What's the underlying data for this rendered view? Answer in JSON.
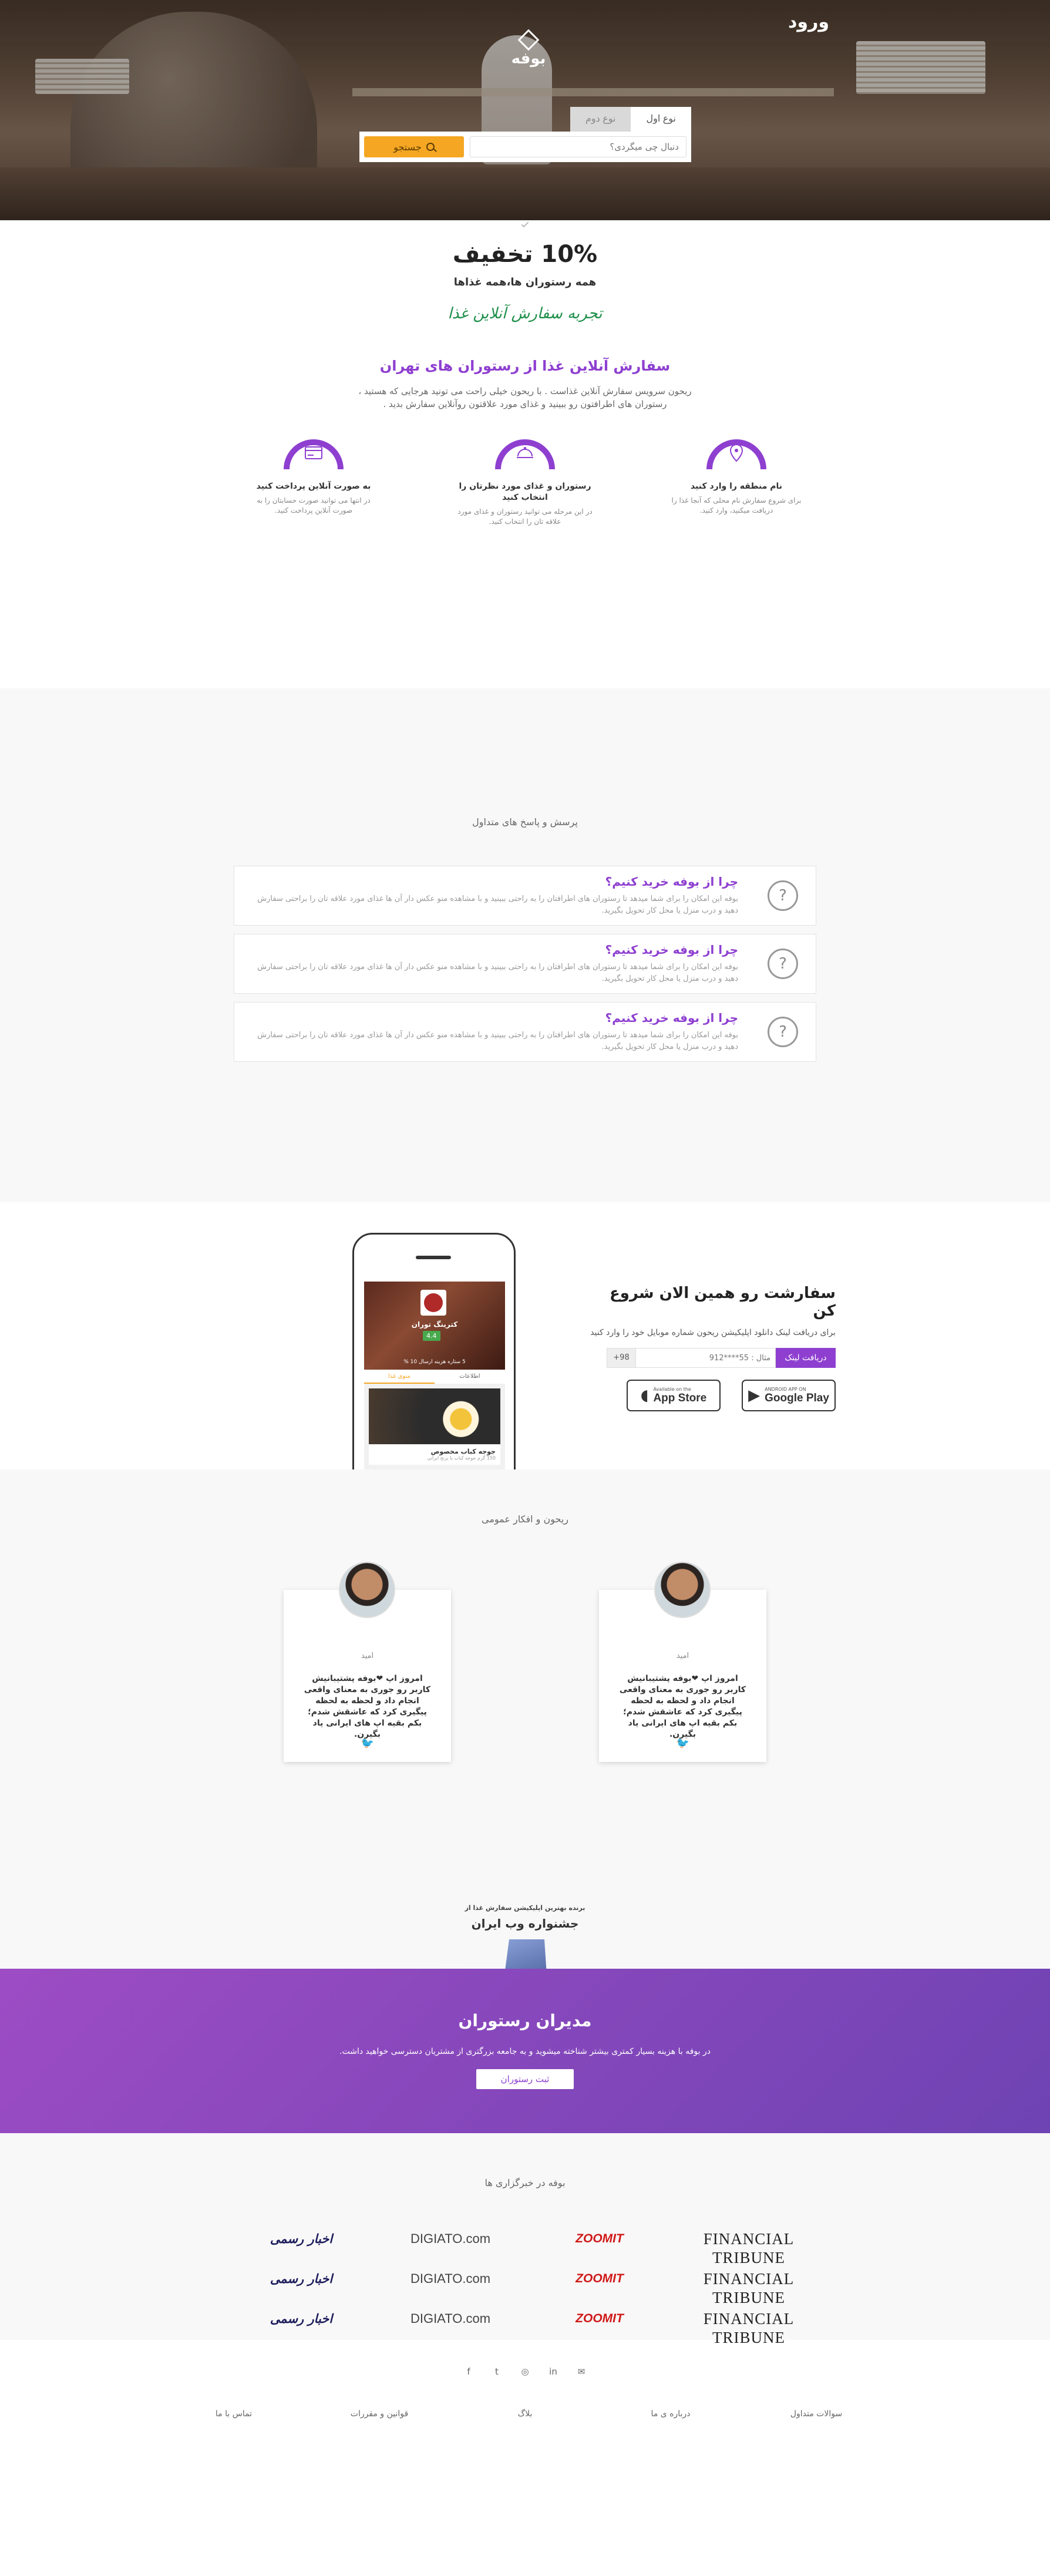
{
  "header": {
    "login": "ورود",
    "logo_text": "بوفه",
    "search_tabs": [
      "نوع اول",
      "نوع دوم"
    ],
    "search_placeholder": "دنبال چی میگردی؟",
    "search_button": "جستجو"
  },
  "discount": {
    "headline": "10% تخفیف",
    "subline": "همه رستوران ها،همه غذاها",
    "calligraphy": "تجربه سفارش آنلاین غذا"
  },
  "about": {
    "title": "سفارش آنلاین غذا از رستوران های تهران",
    "line1": "ریحون سرویس سفارش آنلاین غذاست . با ریحون خیلی راحت می تونید هرجایی که هستید ،",
    "line2": "رستوران های اطرافتون رو ببینید و غذای مورد علاقتون روآنلاین سفارش بدید ."
  },
  "features": [
    {
      "icon": "location-pin-icon",
      "title": "نام منطقه را وارد کنید",
      "desc": "برای شروع سفارش نام محلی که آنجا غذا را دریافت میکنید، وارد کنید."
    },
    {
      "icon": "food-dish-icon",
      "title": "رستوران و غذای مورد نظرتان را انتخاب کنید",
      "desc": "در این مرحله می توانید رستوران و غذای مورد علاقه تان را انتخاب کنید."
    },
    {
      "icon": "credit-card-icon",
      "title": "به صورت آنلاین پرداخت کنید",
      "desc": "در انتها می توانید صورت حسابتان را به صورت آنلاین پرداخت کنید."
    }
  ],
  "faq": {
    "title": "پرسش و پاسخ های متداول",
    "items": [
      {
        "question": "چرا از بوفه خرید کنیم؟",
        "answer_line1": "بوفه این امکان را برای شما میدهد تا رستوران های اطرافتان را به راحتی ببینید و با مشاهده منو عکس دار آن ها غذای مورد علاقه تان را براحتی سفارش",
        "answer_line2": "دهید و درب منزل یا محل کار تحویل بگیرید."
      },
      {
        "question": "چرا از بوفه خرید کنیم؟",
        "answer_line1": "بوفه این امکان را برای شما میدهد تا رستوران های اطرافتان را به راحتی ببینید و با مشاهده منو عکس دار آن ها غذای مورد علاقه تان را براحتی سفارش",
        "answer_line2": "دهید و درب منزل یا محل کار تحویل بگیرید."
      },
      {
        "question": "چرا از بوفه خرید کنیم؟",
        "answer_line1": "بوفه این امکان را برای شما میدهد تا رستوران های اطرافتان را به راحتی ببینید و با مشاهده منو عکس دار آن ها غذای مورد علاقه تان را براحتی سفارش",
        "answer_line2": "دهید و درب منزل یا محل کار تحویل بگیرید."
      }
    ]
  },
  "app": {
    "title": "سفارشت رو همین الان شروع کن",
    "hint": "برای دریافت لینک دانلود اپلیکیشن ریحون شماره موبایل خود را وارد کنید",
    "button": "دریافت لینک",
    "phone_placeholder": "مثال : 55****912",
    "prefix": "98+",
    "appstore_small": "Available on the",
    "appstore_big": "App Store",
    "googleplay_small": "ANDROID APP ON",
    "googleplay_big": "Google Play",
    "screen": {
      "rest_name": "کترینگ توران",
      "rating": "4.4",
      "meta": "5 ستاره     هزینه ارسال     10 %",
      "tab_left": "اطلاعات",
      "tab_right": "منوی غذا",
      "food_title": "جوجه کباب مخصوص",
      "food_sub": "150 گرم جوجه کباب با برنج ایرانی"
    }
  },
  "testimonials": {
    "title": "ریحون و افکار عمومی",
    "cards": [
      {
        "name": "امید",
        "text": "امروز اپ ❤بوفه پشتیبانیش کاربر رو جوری به معنای واقعی انجام داد و لحظه به لحظه پیگیری کرد که عاشقش شدم؛بکم بقیه اپ های ایرانی یاد بگیرن."
      },
      {
        "name": "امید",
        "text": "امروز اپ ❤بوفه پشتیبانیش کاربر رو جوری به معنای واقعی انجام داد و لحظه به لحظه پیگیری کرد که عاشقش شدم؛بکم بقیه اپ های ایرانی یاد بگیرن."
      }
    ]
  },
  "award": {
    "small_title": "برنده بهترین اپلیکیشن سفارش غذا از",
    "title": "جشنواره وب ایران"
  },
  "managers": {
    "title": "مدیران رستوران",
    "text": "در بوفه با هزینه بسیار کمتری بیشتر شناخته میشوید و به جامعه بزرگتری از مشتریان دسترسی خواهید داشت.",
    "button": "ثبت رستوران"
  },
  "news": {
    "title": "بوفه در خبرگزاری ها",
    "logos": [
      "FINANCIAL TRIBUNE",
      "ZOOMIT",
      "DIGIATO.com",
      "اخبار رسمی"
    ]
  },
  "footer": {
    "social": [
      "envelope-icon",
      "linkedin-icon",
      "instagram-icon",
      "twitter-icon",
      "facebook-icon"
    ],
    "links": [
      "سوالات متداول",
      "درباره ی ما",
      "بلاگ",
      "قوانین و مقررات",
      "تماس با ما"
    ]
  },
  "colors": {
    "primary": "#8e3fd0",
    "search_button": "#f5a623",
    "twitter": "#1da1f2"
  }
}
